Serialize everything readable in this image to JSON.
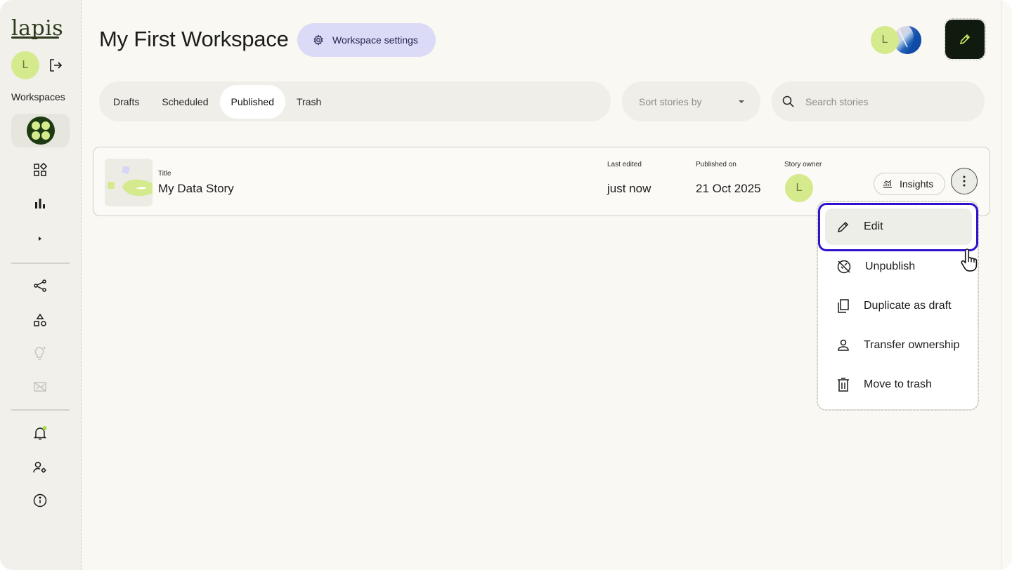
{
  "app": {
    "logo_text": "lapis"
  },
  "sidebar": {
    "user_initial": "L",
    "workspaces_label": "Workspaces",
    "icons": [
      "logout-icon",
      "workspace-logo-icon",
      "dashboard-grid-icon",
      "bar-chart-icon",
      "caret-right-icon",
      "share-icon",
      "shapes-icon",
      "lightbulb-icon",
      "chart-card-icon",
      "bell-icon",
      "user-settings-icon",
      "info-icon"
    ]
  },
  "header": {
    "title": "My First Workspace",
    "settings_label": "Workspace settings",
    "user_initial": "L"
  },
  "tabs": [
    {
      "label": "Drafts",
      "active": false
    },
    {
      "label": "Scheduled",
      "active": false
    },
    {
      "label": "Published",
      "active": true
    },
    {
      "label": "Trash",
      "active": false
    }
  ],
  "sort": {
    "placeholder": "Sort stories by"
  },
  "search": {
    "placeholder": "Search stories"
  },
  "story": {
    "title_label": "Title",
    "title": "My Data Story",
    "last_edited_label": "Last edited",
    "last_edited": "just now",
    "published_label": "Published on",
    "published": "21 Oct 2025",
    "owner_label": "Story owner",
    "owner_initial": "L",
    "insights_label": "Insights"
  },
  "menu": {
    "items": [
      {
        "label": "Edit",
        "icon": "pencil-icon"
      },
      {
        "label": "Unpublish",
        "icon": "unpublish-icon"
      },
      {
        "label": "Duplicate as draft",
        "icon": "duplicate-icon"
      },
      {
        "label": "Transfer ownership",
        "icon": "person-icon"
      },
      {
        "label": "Move to trash",
        "icon": "trash-icon"
      }
    ]
  },
  "colors": {
    "accent_purple": "#dcdbf7",
    "avatar_green": "#d4ea8c",
    "highlight": "#2f12cc",
    "dark_button": "#111a0f"
  }
}
